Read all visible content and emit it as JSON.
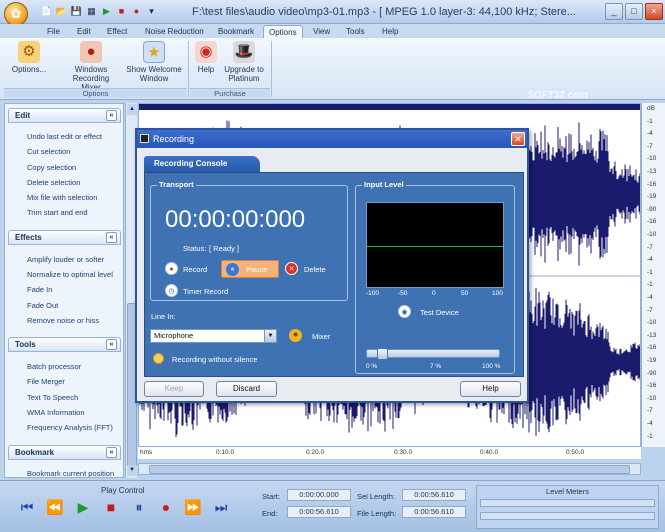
{
  "window": {
    "title": "F:\\test files\\audio video\\mp3-01.mp3 - [ MPEG 1.0 layer-3: 44,100 kHz; Stere...",
    "min": "_",
    "max": "□",
    "close": "×"
  },
  "qat": [
    "📄",
    "📂",
    "💾",
    "▦",
    "▶",
    "■",
    "●",
    "▾"
  ],
  "tabs": [
    "File",
    "Edit",
    "Effect",
    "Noise Reduction",
    "Bookmark",
    "Options",
    "View",
    "Tools",
    "Help"
  ],
  "ribbon": {
    "options_label": "Options...",
    "rec_mixer_label": "Windows Recording Mixer",
    "show_welcome_label": "Show Welcome Window",
    "group_options": "Options",
    "help_label": "Help",
    "upgrade_label": "Upgrade to Platinum",
    "group_purchase": "Purchase"
  },
  "watermark": "SOFT32.com",
  "sidebar": {
    "edit_title": "Edit",
    "edit_items": [
      "Undo last edit or effect",
      "Cut selection",
      "Copy selection",
      "Delete selection",
      "Mix file with selection",
      "Trim start and end"
    ],
    "effects_title": "Effects",
    "effects_items": [
      "Amplify louder or softer",
      "Normalize to optimal level",
      "Fade In",
      "Fade Out",
      "Remove noise or hiss"
    ],
    "tools_title": "Tools",
    "tools_items": [
      "Batch processor",
      "File Merger",
      "Text To Speech",
      "WMA Information",
      "Frequency Analysis (FFT)"
    ],
    "bookmark_title": "Bookmark",
    "bookmark_items": [
      "Bookmark current position"
    ]
  },
  "db_scale": [
    "dB",
    "-1",
    "-4",
    "-7",
    "-10",
    "-13",
    "-16",
    "-19",
    "-90",
    "-16",
    "-10",
    "-7",
    "-4",
    "-1",
    "-1",
    "-4",
    "-7",
    "-10",
    "-13",
    "-16",
    "-19",
    "-90",
    "-16",
    "-10",
    "-7",
    "-4",
    "-1"
  ],
  "timeline": [
    "hms",
    "0:10.0",
    "0:20.0",
    "0:30.0",
    "0:40.0",
    "0:50.0"
  ],
  "bottom": {
    "play_control": "Play Control",
    "start_label": "Start:",
    "start_value": "0:00:00.000",
    "end_label": "End:",
    "end_value": "0:00:56.610",
    "sel_length_label": "Sel Length:",
    "sel_length_value": "0:00:56.610",
    "file_length_label": "File Length:",
    "file_length_value": "0:00:56.610",
    "level_meters": "Level Meters"
  },
  "dialog": {
    "title": "Recording",
    "tab": "Recording Console",
    "transport": "Transport",
    "time": "00:00:00:000",
    "status_label": "Status:",
    "status_value": "[ Ready ]",
    "record": "Record",
    "pause": "Pause",
    "delete": "Delete",
    "timer_record": "Timer Record",
    "line_in": "Line In:",
    "line_in_value": "Microphone",
    "mixer": "Mixer",
    "without_silence": "Recording without silence",
    "input_level": "Input Level",
    "scope_ticks": [
      "-100",
      "-50",
      "0",
      "50",
      "100"
    ],
    "test_device": "Test Device",
    "slider_ticks": [
      "0 %",
      "7 %",
      "100 %"
    ],
    "slider_value": 0.07,
    "keep": "Keep",
    "discard": "Discard",
    "help": "Help"
  },
  "colors": {
    "accent": "#2557b8",
    "panel": "#3f72b3",
    "waveform": "#1b1b6e"
  }
}
